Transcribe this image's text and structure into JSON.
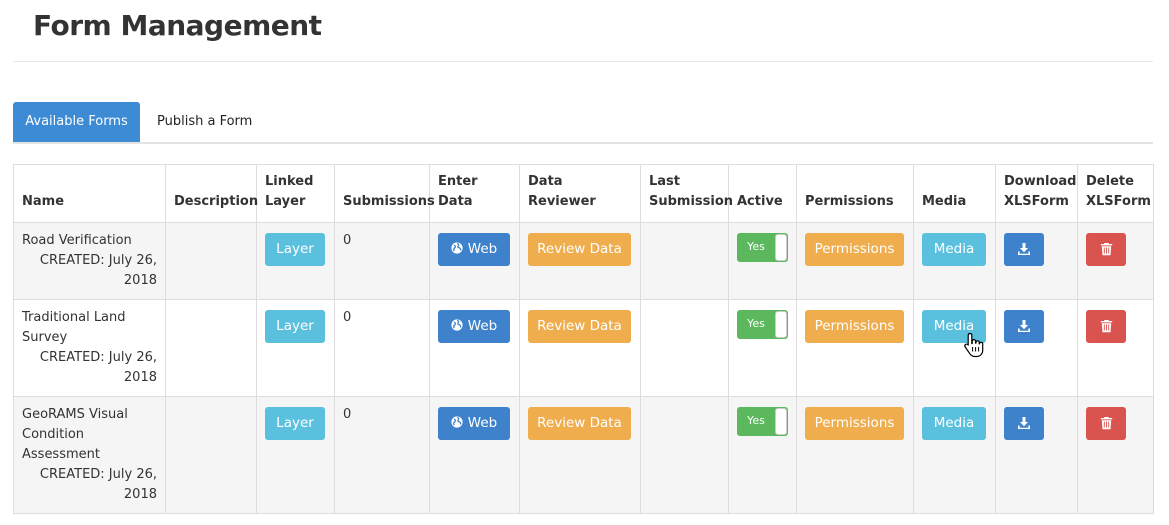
{
  "page": {
    "title": "Form Management"
  },
  "tabs": [
    {
      "label": "Available Forms",
      "active": true
    },
    {
      "label": "Publish a Form",
      "active": false
    }
  ],
  "table": {
    "headers": {
      "name": "Name",
      "description": "Description",
      "linked_layer": "Linked Layer",
      "submissions": "Submissions",
      "enter_data": "Enter Data",
      "data_reviewer": "Data Reviewer",
      "last_submission": "Last Submission",
      "active": "Active",
      "permissions": "Permissions",
      "media": "Media",
      "download": "Download XLSForm",
      "delete": "Delete XLSForm"
    },
    "rows": [
      {
        "name": "Road Verification",
        "created": "CREATED: July 26, 2018",
        "description": "",
        "layer_label": "Layer",
        "submissions": "0",
        "web_label": "Web",
        "review_label": "Review Data",
        "last_submission": "",
        "active_label": "Yes",
        "permissions_label": "Permissions",
        "media_label": "Media"
      },
      {
        "name": "Traditional Land Survey",
        "created": "CREATED: July 26, 2018",
        "description": "",
        "layer_label": "Layer",
        "submissions": "0",
        "web_label": "Web",
        "review_label": "Review Data",
        "last_submission": "",
        "active_label": "Yes",
        "permissions_label": "Permissions",
        "media_label": "Media"
      },
      {
        "name": "GeoRAMS Visual Condition Assessment",
        "created": "CREATED: July 26, 2018",
        "description": "",
        "layer_label": "Layer",
        "submissions": "0",
        "web_label": "Web",
        "review_label": "Review Data",
        "last_submission": "",
        "active_label": "Yes",
        "permissions_label": "Permissions",
        "media_label": "Media"
      }
    ]
  },
  "icons": {
    "web": "globe-icon",
    "download": "download-icon",
    "delete": "trash-icon",
    "cursor": "hand-pointer-icon"
  },
  "colors": {
    "primary": "#3e82cc",
    "tab_active": "#3e8bd5",
    "info": "#5bc0de",
    "warning": "#f0ad4e",
    "success": "#5cb85c",
    "danger": "#d9534f"
  }
}
